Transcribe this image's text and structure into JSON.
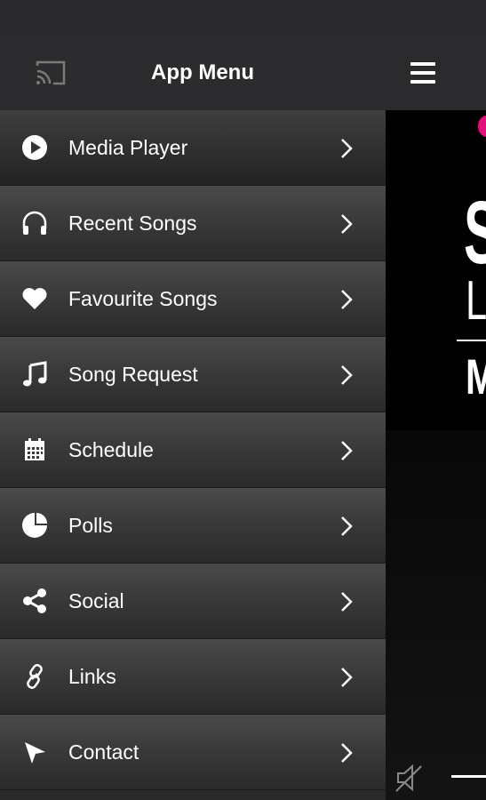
{
  "drawer": {
    "title": "App Menu",
    "cast_icon": "cast-icon",
    "items": [
      {
        "label": "Media Player",
        "icon": "play-circle-icon"
      },
      {
        "label": "Recent Songs",
        "icon": "headphones-icon"
      },
      {
        "label": "Favourite Songs",
        "icon": "heart-icon"
      },
      {
        "label": "Song Request",
        "icon": "music-note-icon"
      },
      {
        "label": "Schedule",
        "icon": "calendar-icon"
      },
      {
        "label": "Polls",
        "icon": "pie-chart-icon"
      },
      {
        "label": "Social",
        "icon": "share-icon"
      },
      {
        "label": "Links",
        "icon": "link-icon"
      },
      {
        "label": "Contact",
        "icon": "send-icon"
      }
    ]
  },
  "content": {
    "menu_icon": "hamburger-icon",
    "mute_icon": "mute-icon",
    "accent_color": "#e0127a"
  }
}
